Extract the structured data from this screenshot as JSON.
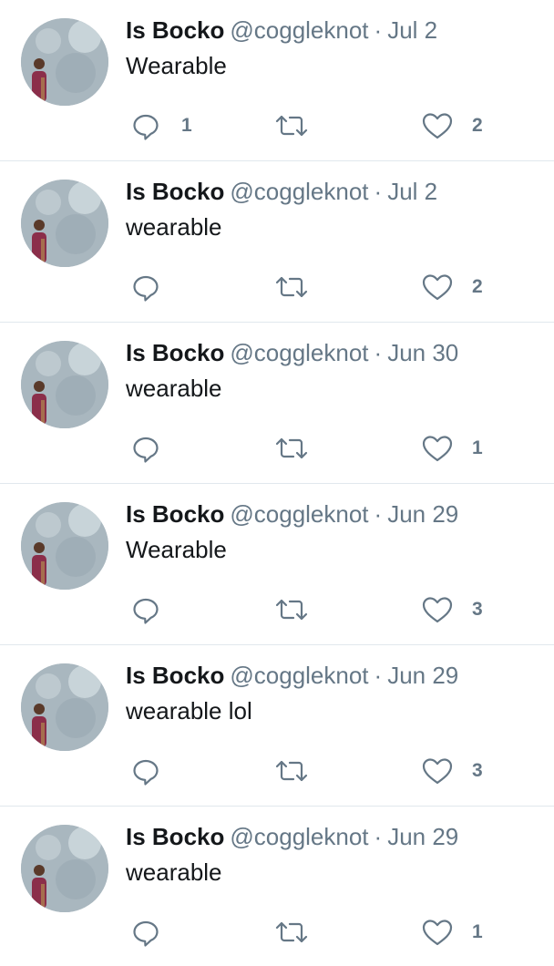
{
  "colors": {
    "text": "#14171a",
    "secondary": "#657786",
    "divider": "#e1e8ed",
    "icon": "#657786"
  },
  "icons": {
    "reply": "reply-icon",
    "retweet": "retweet-icon",
    "like": "heart-icon"
  },
  "tweets": [
    {
      "name": "Is Bocko",
      "handle": "@coggleknot",
      "separator": "·",
      "time": "Jul 2",
      "text": "Wearable",
      "replies": "1",
      "retweets": "",
      "likes": "2"
    },
    {
      "name": "Is Bocko",
      "handle": "@coggleknot",
      "separator": "·",
      "time": "Jul 2",
      "text": "wearable",
      "replies": "",
      "retweets": "",
      "likes": "2"
    },
    {
      "name": "Is Bocko",
      "handle": "@coggleknot",
      "separator": "·",
      "time": "Jun 30",
      "text": "wearable",
      "replies": "",
      "retweets": "",
      "likes": "1"
    },
    {
      "name": "Is Bocko",
      "handle": "@coggleknot",
      "separator": "·",
      "time": "Jun 29",
      "text": "Wearable",
      "replies": "",
      "retweets": "",
      "likes": "3"
    },
    {
      "name": "Is Bocko",
      "handle": "@coggleknot",
      "separator": "·",
      "time": "Jun 29",
      "text": "wearable lol",
      "replies": "",
      "retweets": "",
      "likes": "3"
    },
    {
      "name": "Is Bocko",
      "handle": "@coggleknot",
      "separator": "·",
      "time": "Jun 29",
      "text": "wearable",
      "replies": "",
      "retweets": "",
      "likes": "1"
    }
  ]
}
